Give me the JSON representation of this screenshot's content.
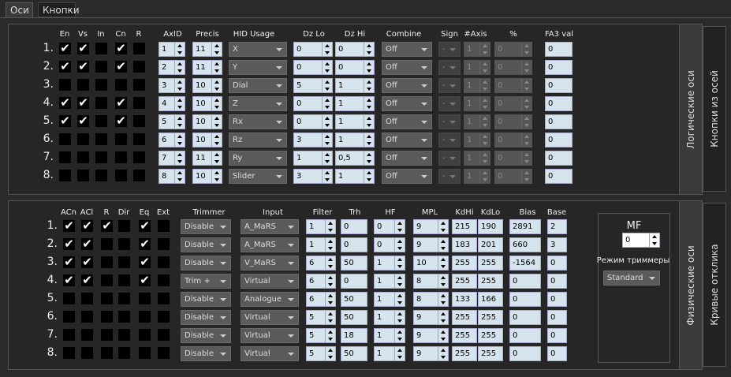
{
  "tabs": [
    "Оси",
    "Кнопки"
  ],
  "logical": {
    "side_tabs": [
      "Логические оси",
      "Кнопки из осей"
    ],
    "flag_headers": [
      "En",
      "Vs",
      "In",
      "Cn",
      "R"
    ],
    "col_headers": [
      "AxID",
      "Precis",
      "HID Usage",
      "Dz Lo",
      "Dz Hi",
      "Combine",
      "Sign",
      "#Axis",
      "%",
      "FA3 val"
    ],
    "rows": [
      {
        "num": "1.",
        "flags": [
          "✔",
          "✔",
          "",
          "✔",
          ""
        ],
        "axid": "1",
        "precis": "11",
        "usage": "X",
        "dzlo": "0",
        "dzhi": "0",
        "combine": "Off",
        "sign": "-",
        "axis": "1",
        "pct": "0",
        "fa3": "0"
      },
      {
        "num": "2.",
        "flags": [
          "✔",
          "✔",
          "",
          "✔",
          ""
        ],
        "axid": "2",
        "precis": "11",
        "usage": "Y",
        "dzlo": "0",
        "dzhi": "0",
        "combine": "Off",
        "sign": "-",
        "axis": "1",
        "pct": "0",
        "fa3": "0"
      },
      {
        "num": "3.",
        "flags": [
          "",
          "",
          "",
          "",
          ""
        ],
        "axid": "3",
        "precis": "10",
        "usage": "Dial",
        "dzlo": "5",
        "dzhi": "1",
        "combine": "Off",
        "sign": "-",
        "axis": "1",
        "pct": "0",
        "fa3": "0"
      },
      {
        "num": "4.",
        "flags": [
          "✔",
          "✔",
          "",
          "✔",
          ""
        ],
        "axid": "4",
        "precis": "10",
        "usage": "Z",
        "dzlo": "0",
        "dzhi": "1",
        "combine": "Off",
        "sign": "-",
        "axis": "1",
        "pct": "0",
        "fa3": "0"
      },
      {
        "num": "5.",
        "flags": [
          "✔",
          "✔",
          "",
          "✔",
          ""
        ],
        "axid": "5",
        "precis": "10",
        "usage": "Rx",
        "dzlo": "0",
        "dzhi": "1",
        "combine": "Off",
        "sign": "-",
        "axis": "1",
        "pct": "0",
        "fa3": "0"
      },
      {
        "num": "6.",
        "flags": [
          "",
          "",
          "",
          "",
          ""
        ],
        "axid": "6",
        "precis": "10",
        "usage": "Rz",
        "dzlo": "3",
        "dzhi": "1",
        "combine": "Off",
        "sign": "-",
        "axis": "1",
        "pct": "0",
        "fa3": "0"
      },
      {
        "num": "7.",
        "flags": [
          "",
          "",
          "",
          "",
          ""
        ],
        "axid": "7",
        "precis": "11",
        "usage": "Ry",
        "dzlo": "1",
        "dzhi": "0,5",
        "combine": "Off",
        "sign": "-",
        "axis": "1",
        "pct": "0",
        "fa3": "0"
      },
      {
        "num": "8.",
        "flags": [
          "",
          "",
          "",
          "",
          ""
        ],
        "axid": "8",
        "precis": "10",
        "usage": "Slider",
        "dzlo": "3",
        "dzhi": "1",
        "combine": "Off",
        "sign": "-",
        "axis": "1",
        "pct": "0",
        "fa3": "0"
      }
    ]
  },
  "physical": {
    "side_tabs": [
      "Физические оси",
      "Кривые отклика"
    ],
    "flag_headers": [
      "ACn",
      "ACl",
      "R",
      "Dir",
      "Eq",
      "Ext"
    ],
    "col_headers": [
      "Trimmer",
      "Input",
      "Filter",
      "Trh",
      "HF",
      "MPL",
      "KdHi",
      "KdLo",
      "Bias",
      "Base"
    ],
    "rows": [
      {
        "num": "1.",
        "flags": [
          "✔",
          "✔",
          "✔",
          "",
          "✔",
          ""
        ],
        "trimmer": "Disable",
        "input": "A_MaRS",
        "filter": "1",
        "trh": "0",
        "hf": "0",
        "mpl": "9",
        "kdhi": "215",
        "kdlo": "190",
        "bias": "2891",
        "base": "2"
      },
      {
        "num": "2.",
        "flags": [
          "✔",
          "✔",
          "",
          "",
          "✔",
          ""
        ],
        "trimmer": "Disable",
        "input": "A_MaRS",
        "filter": "1",
        "trh": "0",
        "hf": "0",
        "mpl": "9",
        "kdhi": "183",
        "kdlo": "201",
        "bias": "660",
        "base": "3"
      },
      {
        "num": "3.",
        "flags": [
          "✔",
          "✔",
          "",
          "",
          "✔",
          ""
        ],
        "trimmer": "Disable",
        "input": "V_MaRS",
        "filter": "6",
        "trh": "50",
        "hf": "1",
        "mpl": "10",
        "kdhi": "255",
        "kdlo": "255",
        "bias": "-1564",
        "base": "0"
      },
      {
        "num": "4.",
        "flags": [
          "✔",
          "✔",
          "",
          "",
          "✔",
          ""
        ],
        "trimmer": "Trim +",
        "input": "Virtual",
        "filter": "6",
        "trh": "0",
        "hf": "1",
        "mpl": "8",
        "kdhi": "255",
        "kdlo": "255",
        "bias": "0",
        "base": "0"
      },
      {
        "num": "5.",
        "flags": [
          "",
          "",
          "",
          "",
          "",
          ""
        ],
        "trimmer": "Disable",
        "input": "Analogue",
        "filter": "6",
        "trh": "50",
        "hf": "1",
        "mpl": "8",
        "kdhi": "133",
        "kdlo": "166",
        "bias": "0",
        "base": "0"
      },
      {
        "num": "6.",
        "flags": [
          "",
          "",
          "",
          "",
          "",
          ""
        ],
        "trimmer": "Disable",
        "input": "Virtual",
        "filter": "5",
        "trh": "50",
        "hf": "1",
        "mpl": "9",
        "kdhi": "255",
        "kdlo": "255",
        "bias": "0",
        "base": "0"
      },
      {
        "num": "7.",
        "flags": [
          "",
          "",
          "",
          "",
          "",
          ""
        ],
        "trimmer": "Disable",
        "input": "Virtual",
        "filter": "5",
        "trh": "18",
        "hf": "1",
        "mpl": "9",
        "kdhi": "255",
        "kdlo": "255",
        "bias": "0",
        "base": "0"
      },
      {
        "num": "8.",
        "flags": [
          "",
          "",
          "",
          "",
          "",
          ""
        ],
        "trimmer": "Disable",
        "input": "Virtual",
        "filter": "5",
        "trh": "50",
        "hf": "1",
        "mpl": "9",
        "kdhi": "255",
        "kdlo": "255",
        "bias": "0",
        "base": "0"
      }
    ],
    "mf_label": "MF",
    "mf_value": "0",
    "trim_mode_label": "Режим триммеры",
    "trim_mode_value": "Standard"
  }
}
